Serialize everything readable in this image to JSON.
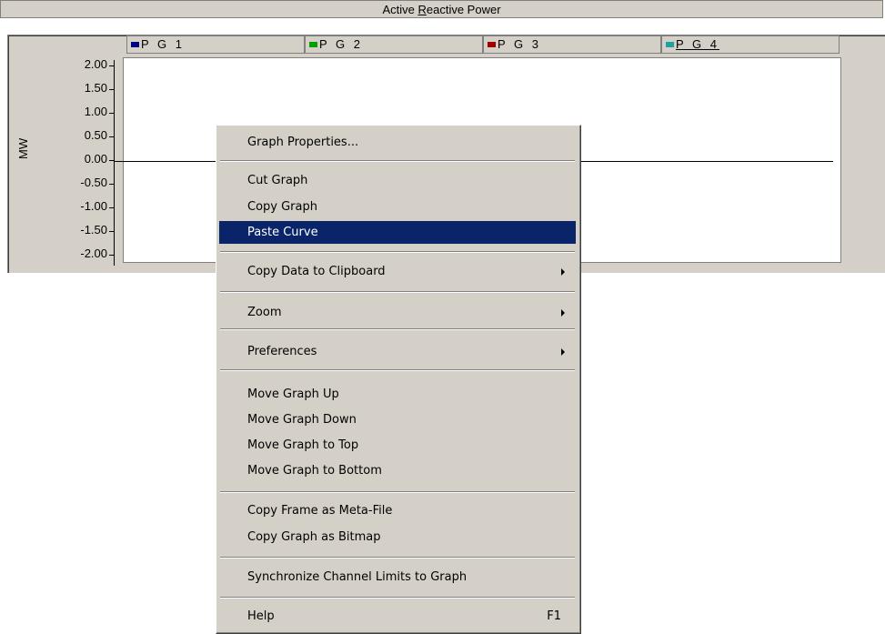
{
  "window": {
    "title_prefix": "Active ",
    "title_underlined": "R",
    "title_suffix": "eactive Power"
  },
  "graph": {
    "ylabel": "MW",
    "legend": [
      {
        "label": "P G 1",
        "color": "#000080"
      },
      {
        "label": "P G 2",
        "color": "#00a000"
      },
      {
        "label": "P G 3",
        "color": "#a00000"
      },
      {
        "label": "P G 4",
        "color": "#20a0a0"
      }
    ],
    "yticks": [
      "2.00",
      "1.50",
      "1.00",
      "0.50",
      "0.00",
      "-0.50",
      "-1.00",
      "-1.50",
      "-2.00"
    ]
  },
  "context_menu": {
    "items": [
      {
        "label": "Graph Properties..."
      },
      {
        "label": "Cut Graph"
      },
      {
        "label": "Copy Graph"
      },
      {
        "label": "Paste Curve"
      },
      {
        "label": "Copy Data to Clipboard"
      },
      {
        "label": "Zoom"
      },
      {
        "label": "Preferences"
      },
      {
        "label": "Move Graph Up"
      },
      {
        "label": "Move Graph Down"
      },
      {
        "label": "Move Graph to Top"
      },
      {
        "label": "Move Graph to Bottom"
      },
      {
        "label": "Copy Frame as Meta-File"
      },
      {
        "label": "Copy Graph as Bitmap"
      },
      {
        "label": "Synchronize Channel Limits to Graph"
      },
      {
        "label": "Help",
        "shortcut": "F1"
      }
    ]
  }
}
